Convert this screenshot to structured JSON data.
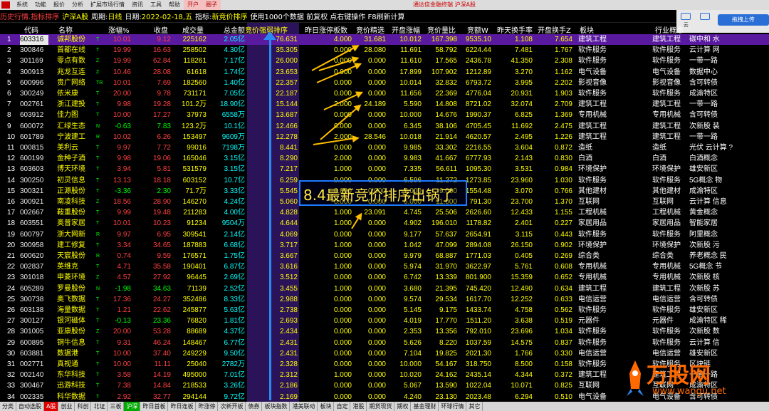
{
  "menubar": {
    "items": [
      "系统",
      "功能",
      "报价",
      "分析",
      "扩展市场行情",
      "资讯",
      "工具",
      "帮助"
    ],
    "open_label": "开户",
    "circle_label": "圈子",
    "center_title": "通达信金融终端  沪深A股",
    "right_items": [
      "行情",
      "资讯",
      "交易",
      "服务"
    ]
  },
  "toolbar_right": {
    "icons": [
      {
        "icon": "cloud-icon",
        "label": "云"
      },
      {
        "icon": "refresh-icon",
        "label": ""
      }
    ],
    "upload_label": "拖拽上传"
  },
  "infobar": {
    "screen_title": "历史行情.指标排序",
    "market": "沪深A股",
    "period_label": "周期:",
    "period_value": "日线",
    "date_label": "日期:",
    "date_value": "2022-02-18,五",
    "indicator_label": "指标:",
    "indicator_value": "新竞价排序",
    "data_note": "使用1000个数据 前复权 点右键操作 F8刷新计算"
  },
  "columns": [
    "代码",
    "名称",
    "涨幅%",
    "收盘",
    "成交量",
    "总金额",
    "竞价强弱排序",
    "昨日涨停板数",
    "竞价精选",
    "开盘涨幅",
    "竞价量比",
    "竞额W",
    "昨天换手率",
    "开盘换手Z",
    "板块",
    "行业概念"
  ],
  "rows": [
    {
      "rank": "1",
      "code": "603316",
      "name": "诚邦股份",
      "mark": "T",
      "pct": "10.01",
      "close": "9.12",
      "vol": "225162",
      "amount": "2.05亿",
      "strength": "76.631",
      "zt": "4.000",
      "jx": "31.681",
      "kpzf": "10.012",
      "ratio": "167.398",
      "je": "9535.10",
      "ztr": "1.108",
      "kphs": "7.654",
      "bk": "建筑工程",
      "hy": "建筑工程",
      "gn": "碳中和 水"
    },
    {
      "rank": "2",
      "code": "300846",
      "name": "首都在线",
      "mark": "T",
      "pct": "19.99",
      "close": "16.63",
      "vol": "258502",
      "amount": "4.30亿",
      "strength": "35.305",
      "zt": "0.000",
      "jx": "28.080",
      "kpzf": "11.691",
      "ratio": "58.792",
      "je": "6224.44",
      "ztr": "7.481",
      "kphs": "1.767",
      "bk": "软件服务",
      "hy": "软件服务",
      "gn": "云计算 网"
    },
    {
      "rank": "3",
      "code": "301169",
      "name": "零点有数",
      "mark": "Z",
      "pct": "19.99",
      "close": "62.84",
      "vol": "118261",
      "amount": "7.17亿",
      "strength": "26.000",
      "zt": "0.000",
      "jx": "0.000",
      "kpzf": "11.610",
      "ratio": "17.565",
      "je": "2436.78",
      "ztr": "41.350",
      "kphs": "2.308",
      "bk": "软件服务",
      "hy": "软件服务",
      "gn": "一带一路"
    },
    {
      "rank": "4",
      "code": "300913",
      "name": "兆龙互连",
      "mark": "Z",
      "pct": "10.46",
      "close": "28.08",
      "vol": "61618",
      "amount": "1.74亿",
      "strength": "23.653",
      "zt": "0.000",
      "jx": "0.000",
      "kpzf": "17.899",
      "ratio": "107.902",
      "je": "1212.89",
      "ztr": "3.270",
      "kphs": "1.162",
      "bk": "电气设备",
      "hy": "电气设备",
      "gn": "数据中心"
    },
    {
      "rank": "5",
      "code": "600996",
      "name": "贵广网络",
      "mark": "TR",
      "pct": "10.01",
      "close": "7.69",
      "vol": "182560",
      "amount": "1.40亿",
      "strength": "22.357",
      "zt": "0.000",
      "jx": "0.000",
      "kpzf": "10.014",
      "ratio": "32.832",
      "je": "6793.72",
      "ztr": "3.995",
      "kphs": "2.202",
      "bk": "影视音像",
      "hy": "影视音像",
      "gn": "含可转债"
    },
    {
      "rank": "6",
      "code": "300249",
      "name": "依米康",
      "mark": "T",
      "pct": "20.00",
      "close": "9.78",
      "vol": "731171",
      "amount": "7.05亿",
      "strength": "22.187",
      "zt": "0.000",
      "jx": "0.000",
      "kpzf": "11.656",
      "ratio": "22.369",
      "je": "4776.04",
      "ztr": "20.931",
      "kphs": "1.903",
      "bk": "软件服务",
      "hy": "软件服务",
      "gn": "成渝特区"
    },
    {
      "rank": "7",
      "code": "002761",
      "name": "浙江建投",
      "mark": "T",
      "pct": "9.98",
      "close": "19.28",
      "vol": "101.2万",
      "amount": "18.90亿",
      "strength": "15.144",
      "zt": "2.000",
      "jx": "24.189",
      "kpzf": "5.590",
      "ratio": "14.808",
      "je": "8721.02",
      "ztr": "32.074",
      "kphs": "2.709",
      "bk": "建筑工程",
      "hy": "建筑工程",
      "gn": "一带一路"
    },
    {
      "rank": "8",
      "code": "603912",
      "name": "佳力图",
      "mark": "T",
      "pct": "10.00",
      "close": "17.27",
      "vol": "37973",
      "amount": "6558万",
      "strength": "13.687",
      "zt": "0.000",
      "jx": "0.000",
      "kpzf": "10.000",
      "ratio": "14.676",
      "je": "1990.37",
      "ztr": "6.825",
      "kphs": "1.369",
      "bk": "专用机械",
      "hy": "专用机械",
      "gn": "含可转债"
    },
    {
      "rank": "9",
      "code": "600072",
      "name": "汇绿生态",
      "mark": "N",
      "pct": "-0.63",
      "close": "7.83",
      "vol": "123.2万",
      "amount": "10.1亿",
      "strength": "12.466",
      "zt": "0.000",
      "jx": "0.000",
      "kpzf": "6.345",
      "ratio": "38.106",
      "je": "4705.45",
      "ztr": "11.692",
      "kphs": "2.475",
      "bk": "建筑工程",
      "hy": "建筑工程",
      "gn": "次新股 装"
    },
    {
      "rank": "10",
      "code": "601789",
      "name": "宁波建工",
      "mark": "R",
      "pct": "10.02",
      "close": "6.26",
      "vol": "153497",
      "amount": "9609万",
      "strength": "12.278",
      "zt": "2.000",
      "jx": "28.546",
      "kpzf": "10.018",
      "ratio": "21.914",
      "je": "4620.57",
      "ztr": "2.495",
      "kphs": "1.226",
      "bk": "建筑工程",
      "hy": "建筑工程",
      "gn": "一带一路"
    },
    {
      "rank": "11",
      "code": "000815",
      "name": "美利云",
      "mark": "T",
      "pct": "9.97",
      "close": "7.72",
      "vol": "99016",
      "amount": "7198万",
      "strength": "8.441",
      "zt": "0.000",
      "jx": "0.000",
      "kpzf": "9.985",
      "ratio": "33.302",
      "je": "2216.55",
      "ztr": "3.604",
      "kphs": "0.872",
      "bk": "造纸",
      "hy": "造纸",
      "gn": "光伏 云计算 ?"
    },
    {
      "rank": "12",
      "code": "600199",
      "name": "金种子酒",
      "mark": "T",
      "pct": "9.98",
      "close": "19.06",
      "vol": "165046",
      "amount": "3.15亿",
      "strength": "8.290",
      "zt": "2.000",
      "jx": "0.000",
      "kpzf": "9.983",
      "ratio": "41.667",
      "je": "6777.93",
      "ztr": "2.143",
      "kphs": "0.830",
      "bk": "白酒",
      "hy": "白酒",
      "gn": "白酒概念"
    },
    {
      "rank": "13",
      "code": "603603",
      "name": "博天环境",
      "mark": "T",
      "pct": "3.94",
      "close": "5.81",
      "vol": "531579",
      "amount": "3.15亿",
      "strength": "7.217",
      "zt": "1.000",
      "jx": "0.000",
      "kpzf": "7.335",
      "ratio": "56.611",
      "je": "1095.30",
      "ztr": "3.531",
      "kphs": "0.984",
      "bk": "环境保护",
      "hy": "环境保护",
      "gn": "雄安新区"
    },
    {
      "rank": "14",
      "code": "300250",
      "name": "初灵信息",
      "mark": "T",
      "pct": "13.13",
      "close": "18.18",
      "vol": "603152",
      "amount": "10.7亿",
      "strength": "6.259",
      "zt": "0.000",
      "jx": "0.000",
      "kpzf": "6.596",
      "ratio": "11.272",
      "je": "1273.85",
      "ztr": "23.960",
      "kphs": "1.030",
      "bk": "软件服务",
      "hy": "软件服务",
      "gn": "5G概念 物"
    },
    {
      "rank": "15",
      "code": "300321",
      "name": "正源股份",
      "mark": "T",
      "pct": "-3.36",
      "close": "2.30",
      "vol": "71.7万",
      "amount": "3.33亿",
      "strength": "5.545",
      "zt": "0.000",
      "jx": "0.000",
      "kpzf": "7.000",
      "ratio": "9.000",
      "je": "1554.48",
      "ztr": "3.070",
      "kphs": "0.766",
      "bk": "其他建材",
      "hy": "其他建材",
      "gn": "成渝特区"
    },
    {
      "rank": "16",
      "code": "300921",
      "name": "南凌科技",
      "mark": "Z",
      "pct": "18.56",
      "close": "28.90",
      "vol": "146270",
      "amount": "4.24亿",
      "strength": "5.060",
      "zt": "0.000",
      "jx": "0.000",
      "kpzf": "6.000",
      "ratio": "11.000",
      "je": "791.30",
      "ztr": "23.700",
      "kphs": "1.370",
      "bk": "互联网",
      "hy": "互联网",
      "gn": "云计算 信息"
    },
    {
      "rank": "17",
      "code": "002667",
      "name": "鞍重股份",
      "mark": "T",
      "pct": "9.99",
      "close": "19.48",
      "vol": "211283",
      "amount": "4.00亿",
      "strength": "4.828",
      "zt": "1.000",
      "jx": "23.091",
      "kpzf": "4.745",
      "ratio": "25.506",
      "je": "2626.60",
      "ztr": "12.433",
      "kphs": "1.155",
      "bk": "工程机械",
      "hy": "工程机械",
      "gn": "黄金概念"
    },
    {
      "rank": "18",
      "code": "603551",
      "name": "奥普家居",
      "mark": "T",
      "pct": "10.01",
      "close": "10.23",
      "vol": "91234",
      "amount": "9504万",
      "strength": "4.644",
      "zt": "1.000",
      "jx": "0.000",
      "kpzf": "4.902",
      "ratio": "196.010",
      "je": "1178.82",
      "ztr": "2.401",
      "kphs": "0.227",
      "bk": "家居用品",
      "hy": "家居用品",
      "gn": "智能家居"
    },
    {
      "rank": "19",
      "code": "600797",
      "name": "浙大网新",
      "mark": "R",
      "pct": "9.97",
      "close": "6.95",
      "vol": "309541",
      "amount": "2.14亿",
      "strength": "4.069",
      "zt": "0.000",
      "jx": "0.000",
      "kpzf": "9.177",
      "ratio": "57.637",
      "je": "2654.91",
      "ztr": "3.115",
      "kphs": "0.443",
      "bk": "软件服务",
      "hy": "软件服务",
      "gn": "阿里概念"
    },
    {
      "rank": "20",
      "code": "300958",
      "name": "建工修复",
      "mark": "T",
      "pct": "3.34",
      "close": "34.65",
      "vol": "187883",
      "amount": "6.68亿",
      "strength": "3.717",
      "zt": "1.000",
      "jx": "0.000",
      "kpzf": "1.042",
      "ratio": "47.099",
      "je": "2894.08",
      "ztr": "26.150",
      "kphs": "0.902",
      "bk": "环境保护",
      "hy": "环境保护",
      "gn": "次新股 污"
    },
    {
      "rank": "21",
      "code": "600620",
      "name": "天宸股份",
      "mark": "R",
      "pct": "0.74",
      "close": "9.59",
      "vol": "176571",
      "amount": "1.75亿",
      "strength": "3.667",
      "zt": "0.000",
      "jx": "0.000",
      "kpzf": "9.979",
      "ratio": "68.887",
      "je": "1771.03",
      "ztr": "0.405",
      "kphs": "0.269",
      "bk": "综合类",
      "hy": "综合类",
      "gn": "养老概念 民"
    },
    {
      "rank": "22",
      "code": "002837",
      "name": "英维克",
      "mark": "T",
      "pct": "4.71",
      "close": "35.58",
      "vol": "190401",
      "amount": "6.87亿",
      "strength": "3.616",
      "zt": "1.000",
      "jx": "0.000",
      "kpzf": "5.974",
      "ratio": "31.970",
      "je": "3622.97",
      "ztr": "5.761",
      "kphs": "0.608",
      "bk": "专用机械",
      "hy": "专用机械",
      "gn": "5G概念 节"
    },
    {
      "rank": "23",
      "code": "301018",
      "name": "申菱环境",
      "mark": "Z",
      "pct": "4.57",
      "close": "27.92",
      "vol": "96445",
      "amount": "2.69亿",
      "strength": "3.512",
      "zt": "0.000",
      "jx": "0.000",
      "kpzf": "6.742",
      "ratio": "13.339",
      "je": "801.900",
      "ztr": "15.359",
      "kphs": "0.652",
      "bk": "专用机械",
      "hy": "专用机械",
      "gn": "次新股 核"
    },
    {
      "rank": "24",
      "code": "605289",
      "name": "罗曼股份",
      "mark": "N",
      "pct": "-1.98",
      "close": "34.63",
      "vol": "71139",
      "amount": "2.52亿",
      "strength": "3.455",
      "zt": "1.000",
      "jx": "0.000",
      "kpzf": "3.680",
      "ratio": "21.395",
      "je": "745.420",
      "ztr": "12.490",
      "kphs": "0.634",
      "bk": "建筑工程",
      "hy": "建筑工程",
      "gn": "次新股 苏"
    },
    {
      "rank": "25",
      "code": "300738",
      "name": "奥飞数据",
      "mark": "T",
      "pct": "17.36",
      "close": "24.27",
      "vol": "352486",
      "amount": "8.33亿",
      "strength": "2.988",
      "zt": "0.000",
      "jx": "0.000",
      "kpzf": "9.574",
      "ratio": "29.534",
      "je": "1617.70",
      "ztr": "12.252",
      "kphs": "0.633",
      "bk": "电信运营",
      "hy": "电信运营",
      "gn": "含可转债"
    },
    {
      "rank": "26",
      "code": "603138",
      "name": "海量数据",
      "mark": "T",
      "pct": "1.21",
      "close": "22.62",
      "vol": "245877",
      "amount": "5.63亿",
      "strength": "2.738",
      "zt": "0.000",
      "jx": "0.000",
      "kpzf": "5.145",
      "ratio": "9.175",
      "je": "1433.74",
      "ztr": "4.758",
      "kphs": "0.562",
      "bk": "软件服务",
      "hy": "软件服务",
      "gn": "雄安新区"
    },
    {
      "rank": "27",
      "code": "300127",
      "name": "银河磁体",
      "mark": "T",
      "pct": "-0.13",
      "close": "23.36",
      "vol": "76820",
      "amount": "1.81亿",
      "strength": "2.693",
      "zt": "0.000",
      "jx": "0.000",
      "kpzf": "4.019",
      "ratio": "17.770",
      "je": "1511.20",
      "ztr": "3.638",
      "kphs": "0.519",
      "bk": "元器件",
      "hy": "元器件",
      "gn": "成渝特区 稀"
    },
    {
      "rank": "28",
      "code": "301005",
      "name": "亚康股份",
      "mark": "Z",
      "pct": "20.00",
      "close": "53.28",
      "vol": "88689",
      "amount": "4.37亿",
      "strength": "2.434",
      "zt": "0.000",
      "jx": "0.000",
      "kpzf": "2.353",
      "ratio": "13.356",
      "je": "792.010",
      "ztr": "23.696",
      "kphs": "1.034",
      "bk": "软件服务",
      "hy": "软件服务",
      "gn": "次新股 数"
    },
    {
      "rank": "29",
      "code": "600895",
      "name": "铜牛信息",
      "mark": "T",
      "pct": "9.31",
      "close": "46.24",
      "vol": "148467",
      "amount": "6.77亿",
      "strength": "2.431",
      "zt": "0.000",
      "jx": "0.000",
      "kpzf": "5.626",
      "ratio": "8.220",
      "je": "1037.59",
      "ztr": "14.575",
      "kphs": "0.837",
      "bk": "软件服务",
      "hy": "软件服务",
      "gn": "云计算 信"
    },
    {
      "rank": "30",
      "code": "603881",
      "name": "数据港",
      "mark": "T",
      "pct": "10.00",
      "close": "37.40",
      "vol": "249229",
      "amount": "9.50亿",
      "strength": "2.431",
      "zt": "0.000",
      "jx": "0.000",
      "kpzf": "7.104",
      "ratio": "19.825",
      "je": "2021.30",
      "ztr": "1.766",
      "kphs": "0.330",
      "bk": "电信运营",
      "hy": "电信运营",
      "gn": "雄安新区"
    },
    {
      "rank": "31",
      "code": "002771",
      "name": "真视通",
      "mark": "T",
      "pct": "10.00",
      "close": "11.11",
      "vol": "25040",
      "amount": "2782万",
      "strength": "2.328",
      "zt": "0.000",
      "jx": "0.000",
      "kpzf": "10.000",
      "ratio": "54.167",
      "je": "318.750",
      "ztr": "8.500",
      "kphs": "0.158",
      "bk": "软件服务",
      "hy": "软件服务",
      "gn": "区块链"
    },
    {
      "rank": "32",
      "code": "002140",
      "name": "东华科技",
      "mark": "T",
      "pct": "3.58",
      "close": "14.19",
      "vol": "495000",
      "amount": "7.01亿",
      "strength": "2.312",
      "zt": "1.000",
      "jx": "0.000",
      "kpzf": "10.020",
      "ratio": "24.162",
      "je": "2435.14",
      "ztr": "4.344",
      "kphs": "0.372",
      "bk": "建筑工程",
      "hy": "建筑工程",
      "gn": "一带一路"
    },
    {
      "rank": "33",
      "code": "300467",
      "name": "迅游科技",
      "mark": "T",
      "pct": "7.38",
      "close": "14.84",
      "vol": "218533",
      "amount": "3.26亿",
      "strength": "2.186",
      "zt": "0.000",
      "jx": "0.000",
      "kpzf": "5.067",
      "ratio": "13.590",
      "je": "1022.04",
      "ztr": "10.071",
      "kphs": "0.825",
      "bk": "互联网",
      "hy": "互联网",
      "gn": "成渝特区"
    },
    {
      "rank": "34",
      "code": "002335",
      "name": "科华数据",
      "mark": "T",
      "pct": "2.92",
      "close": "32.77",
      "vol": "294144",
      "amount": "9.72亿",
      "strength": "2.169",
      "zt": "0.000",
      "jx": "0.000",
      "kpzf": "4.240",
      "ratio": "23.130",
      "je": "2023.48",
      "ztr": "6.294",
      "kphs": "0.510",
      "bk": "电气设备",
      "hy": "电气设备",
      "gn": "含可转债"
    }
  ],
  "annotation": {
    "text": "8.4最新竞价排序出锅了"
  },
  "tabs": [
    "分类",
    "自动选股",
    "A股",
    "创业",
    "科创",
    "北证",
    "三板",
    "沪深",
    "昨日首板",
    "昨日连板",
    "昨涨停",
    "次新开板",
    "债券",
    "板块指数",
    "港美联动",
    "板块",
    "自定",
    "港股",
    "期货现货",
    "期权",
    "基金理财",
    "环球行情",
    "其它"
  ],
  "active_tab": "A股",
  "watermark": {
    "brand": "万股网",
    "url": "www.wangu.net"
  },
  "colors": {
    "up": "#ff4040",
    "down": "#00ff00",
    "name": "#ffff00",
    "accent": "#2a8af2",
    "annotation": "#ffe640",
    "arrow": "#ffc000",
    "selected_bg": "#5a1aa0"
  }
}
